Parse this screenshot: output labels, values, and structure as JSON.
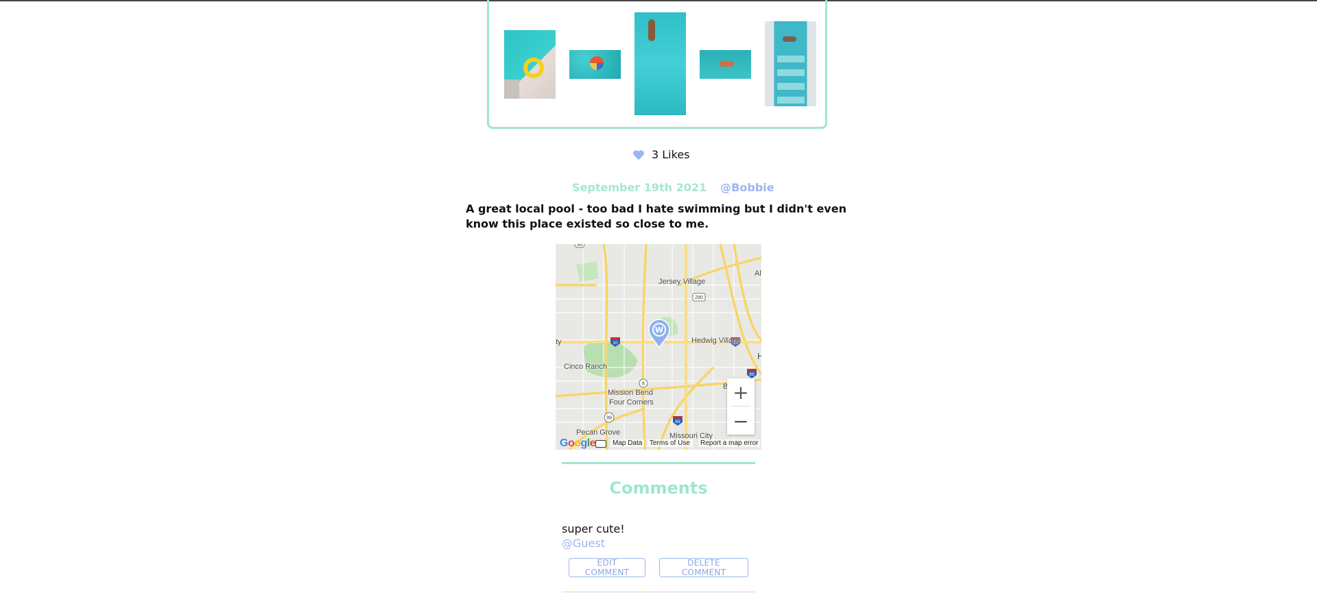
{
  "post": {
    "likes_label": "3 Likes",
    "date": "September 19th 2021",
    "author": "@Bobbie",
    "caption": "A great local pool - too bad I hate swimming but I didn't even know this place existed so close to me.",
    "accent_color": "#9ee6d0",
    "link_color": "#9bb6f0"
  },
  "map": {
    "labels": [
      "Jersey Village",
      "Hedwig Village",
      "Cinco Ranch",
      "Mission Bend",
      "Four Corners",
      "Pecan Grove",
      "Missouri City",
      "ty",
      "H",
      "Al",
      "B"
    ],
    "highway_shields": [
      "99",
      "290",
      "10",
      "10",
      "6",
      "99",
      "69",
      "69"
    ],
    "zoom_in": "+",
    "zoom_out": "−",
    "footer": {
      "map_data": "Map Data",
      "terms": "Terms of Use",
      "report": "Report a map error"
    }
  },
  "comments": {
    "title": "Comments",
    "items": [
      {
        "text": "super cute!",
        "user": "@Guest",
        "edit_label": "EDIT COMMENT",
        "delete_label": "DELETE COMMENT"
      }
    ]
  }
}
